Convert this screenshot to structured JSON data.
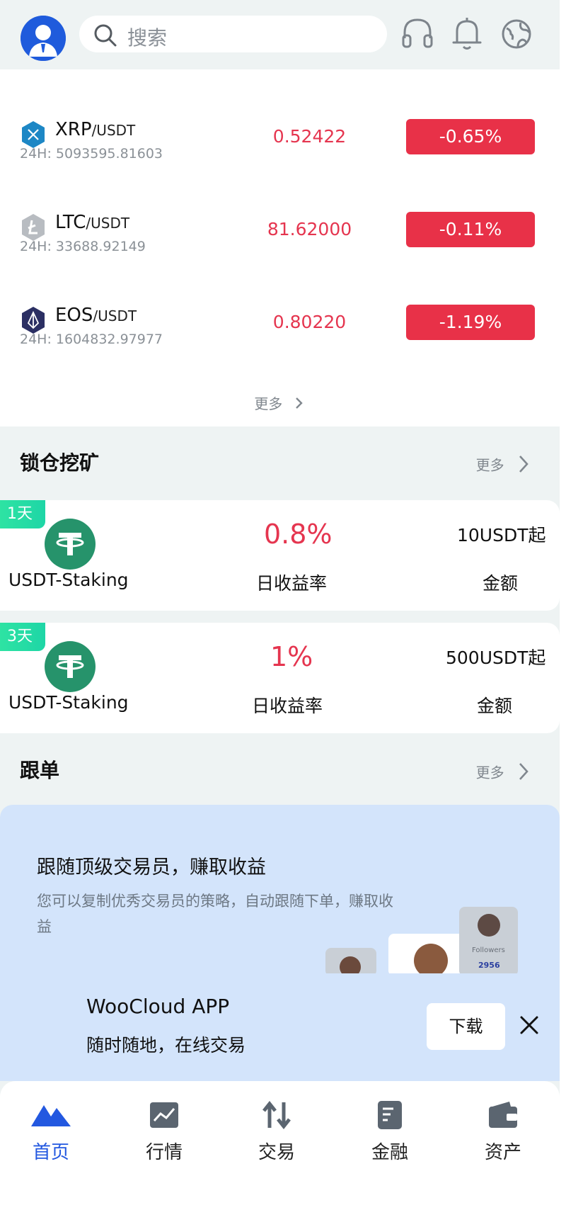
{
  "header": {
    "search_placeholder": "搜索"
  },
  "market": {
    "rows": [
      {
        "base": "XRP",
        "quote": "/USDT",
        "volume": "24H: 5093595.81603",
        "price": "0.52422",
        "change": "-0.65%"
      },
      {
        "base": "LTC",
        "quote": "/USDT",
        "volume": "24H: 33688.92149",
        "price": "81.62000",
        "change": "-0.11%"
      },
      {
        "base": "EOS",
        "quote": "/USDT",
        "volume": "24H: 1604832.97977",
        "price": "0.80220",
        "change": "-1.19%"
      }
    ],
    "more_label": "更多"
  },
  "staking": {
    "title": "锁仓挖矿",
    "more_label": "更多",
    "items": [
      {
        "days": "1天",
        "name": "USDT-Staking",
        "rate": "0.8%",
        "rate_label": "日收益率",
        "min_amount": "10USDT起",
        "amount_label": "金额"
      },
      {
        "days": "3天",
        "name": "USDT-Staking",
        "rate": "1%",
        "rate_label": "日收益率",
        "min_amount": "500USDT起",
        "amount_label": "金额"
      }
    ]
  },
  "copy_trade": {
    "title": "跟单",
    "more_label": "更多",
    "banner_title": "跟随顶级交易员，赚取收益",
    "banner_desc": "您可以复制优秀交易员的策略，自动跟随下单，赚取收益",
    "followers_label": "Followers",
    "followers_count": "2956"
  },
  "download": {
    "app_name": "WooCloud APP",
    "subtitle": "随时随地，在线交易",
    "button": "下载"
  },
  "nav": {
    "items": [
      {
        "label": "首页",
        "active": true
      },
      {
        "label": "行情",
        "active": false
      },
      {
        "label": "交易",
        "active": false
      },
      {
        "label": "金融",
        "active": false
      },
      {
        "label": "资产",
        "active": false
      }
    ]
  },
  "colors": {
    "accent": "#2358e0",
    "down": "#e83148",
    "staking_green": "#26936b",
    "banner_bg": "#d3e4fb"
  }
}
